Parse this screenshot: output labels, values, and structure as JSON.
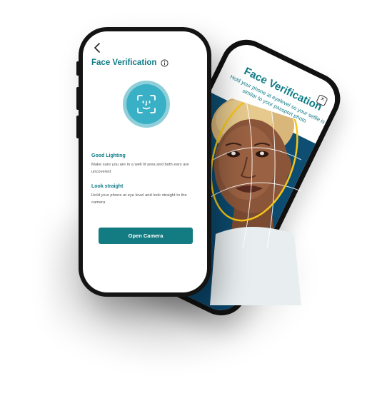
{
  "front": {
    "title": "Face Verification",
    "sections": [
      {
        "heading": "Good Lighting",
        "body": "Make sure you are in a well lit area and both ears are uncovered"
      },
      {
        "heading": "Look straight",
        "body": "Hold your phone at eye level and look straight to the camera"
      }
    ],
    "open_camera_label": "Open Camera"
  },
  "back": {
    "title": "Face Verification",
    "subtitle": "Hold your phone at eyelevel so your selfie is similar to your passport photo"
  },
  "colors": {
    "accent": "#0f7b86",
    "button": "#137b82",
    "badge_outer": "#8fcfd9",
    "badge_inner": "#3ab0c6",
    "photo_background": "#0d4f73",
    "face_outline": "#f5c518"
  },
  "icons": [
    "back-arrow-icon",
    "info-icon",
    "face-id-icon",
    "close-icon"
  ]
}
